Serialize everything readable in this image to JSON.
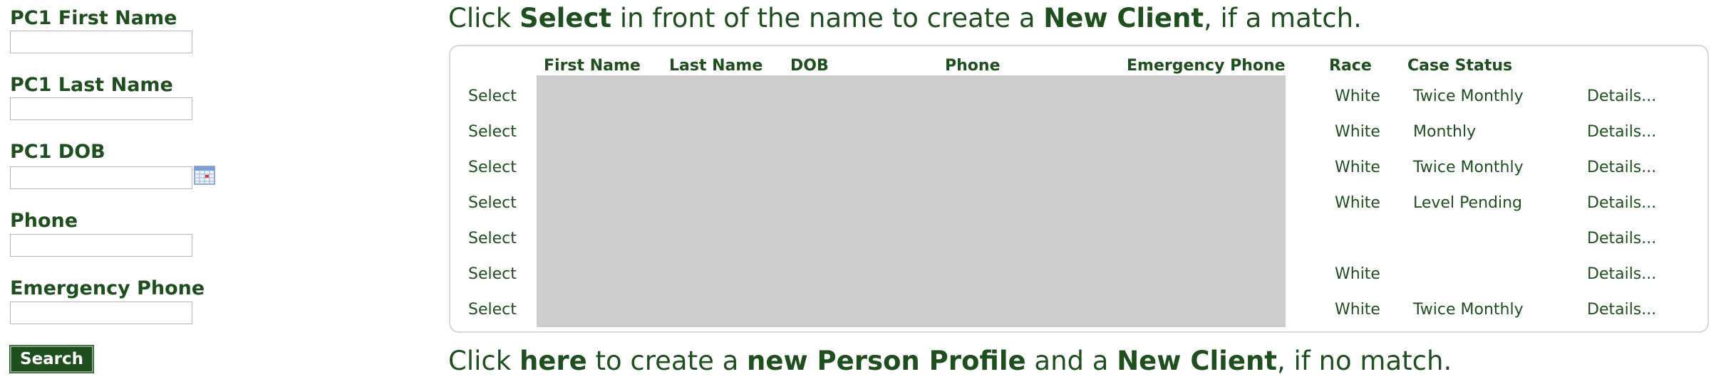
{
  "form": {
    "fields": [
      {
        "label": "PC1 First Name",
        "value": ""
      },
      {
        "label": "PC1 Last Name",
        "value": ""
      },
      {
        "label": "PC1 DOB",
        "value": ""
      },
      {
        "label": "Phone",
        "value": ""
      },
      {
        "label": "Emergency Phone",
        "value": ""
      }
    ],
    "calendar_icon": "calendar-icon",
    "search_label": "Search"
  },
  "top_message": {
    "t1": "Click ",
    "b1": "Select",
    "t2": " in front of the name to create a ",
    "b2": "New Client",
    "t3": ", if a match."
  },
  "table": {
    "columns": [
      "First Name",
      "Last Name",
      "DOB",
      "Phone",
      "Emergency Phone",
      "Race",
      "Case Status"
    ],
    "rows": [
      {
        "select": "Select",
        "race": "White",
        "status": "Twice Monthly",
        "details": "Details..."
      },
      {
        "select": "Select",
        "race": "White",
        "status": "Monthly",
        "details": "Details..."
      },
      {
        "select": "Select",
        "race": "White",
        "status": "Twice Monthly",
        "details": "Details..."
      },
      {
        "select": "Select",
        "race": "White",
        "status": "Level Pending",
        "details": "Details..."
      },
      {
        "select": "Select",
        "race": "",
        "status": "",
        "details": "Details..."
      },
      {
        "select": "Select",
        "race": "White",
        "status": "",
        "details": "Details..."
      },
      {
        "select": "Select",
        "race": "White",
        "status": "Twice Monthly",
        "details": "Details..."
      }
    ]
  },
  "bottom_message": {
    "t1": "Click ",
    "link": "here",
    "t2": " to create a ",
    "b1": "new Person Profile",
    "t3": " and a ",
    "b2": "New Client",
    "t4": ", if no match."
  },
  "colors": {
    "text": "#1f4f1f",
    "button_bg": "#1f4f1f",
    "redaction": "#cdcdcd"
  }
}
